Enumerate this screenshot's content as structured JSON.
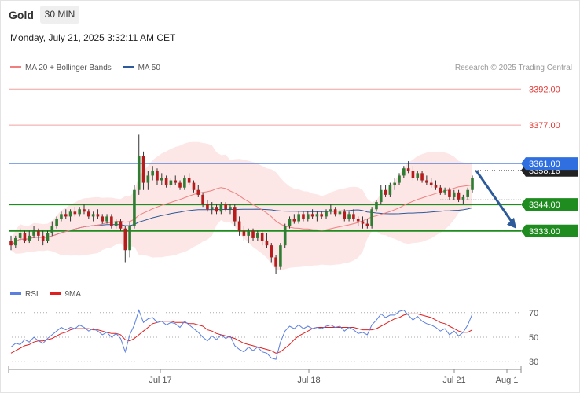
{
  "header": {
    "title": "Gold",
    "interval": "30 MIN",
    "timestamp": "Monday, July 21, 2025 3:32:11 AM CET",
    "copyright": "Research © 2025 Trading Central"
  },
  "legend": {
    "ma20_label": "MA 20 + Bollinger Bands",
    "ma20_color": "#f08080",
    "ma50_label": "MA 50",
    "ma50_color": "#2d5a9a",
    "rsi_label": "RSI",
    "rsi_color": "#5b7fe0",
    "rsi_ma_label": "9MA",
    "rsi_ma_color": "#e02020"
  },
  "colors": {
    "up": "#2e7d32",
    "down": "#b71c1c",
    "resistance": "#e53935",
    "support": "#1e8c1e",
    "pivot": "#3a6fd8",
    "arrow": "#2d5a9a",
    "band_fill": "#fde2e2"
  },
  "chart_data": [
    {
      "type": "candlestick",
      "instrument": "Gold",
      "timeframe": "30 MIN",
      "x_ticks": [
        "Jul 17",
        "Jul 18",
        "Jul 21",
        "Aug 1"
      ],
      "ylim": [
        3312,
        3397
      ],
      "levels": [
        {
          "label": "3392.00",
          "value": 3392,
          "kind": "resistance"
        },
        {
          "label": "3377.00",
          "value": 3377,
          "kind": "resistance"
        },
        {
          "label": "3361.00",
          "value": 3361,
          "kind": "pivot"
        },
        {
          "label": "3358.16",
          "value": 3358.16,
          "kind": "last"
        },
        {
          "label": "3344.00",
          "value": 3344,
          "kind": "support"
        },
        {
          "label": "3333.00",
          "value": 3333,
          "kind": "support"
        }
      ],
      "forecast": {
        "from": 3361,
        "to": 3333,
        "direction": "down"
      },
      "candles": [
        [
          3329,
          3331,
          3325,
          3327
        ],
        [
          3327,
          3331,
          3326,
          3330
        ],
        [
          3330,
          3334,
          3329,
          3332
        ],
        [
          3332,
          3333,
          3328,
          3329
        ],
        [
          3329,
          3333,
          3328,
          3331
        ],
        [
          3331,
          3335,
          3330,
          3333
        ],
        [
          3333,
          3334,
          3329,
          3331
        ],
        [
          3331,
          3333,
          3327,
          3329
        ],
        [
          3329,
          3333,
          3328,
          3332
        ],
        [
          3332,
          3337,
          3331,
          3335
        ],
        [
          3335,
          3339,
          3334,
          3338
        ],
        [
          3338,
          3341,
          3337,
          3340
        ],
        [
          3340,
          3342,
          3338,
          3339
        ],
        [
          3339,
          3342,
          3337,
          3341
        ],
        [
          3341,
          3343,
          3339,
          3340
        ],
        [
          3340,
          3343,
          3339,
          3342
        ],
        [
          3342,
          3344,
          3340,
          3341
        ],
        [
          3341,
          3342,
          3338,
          3339
        ],
        [
          3339,
          3341,
          3337,
          3340
        ],
        [
          3340,
          3342,
          3338,
          3339
        ],
        [
          3339,
          3340,
          3336,
          3337
        ],
        [
          3337,
          3340,
          3336,
          3339
        ],
        [
          3339,
          3340,
          3334,
          3335
        ],
        [
          3335,
          3338,
          3334,
          3337
        ],
        [
          3337,
          3338,
          3333,
          3334
        ],
        [
          3334,
          3335,
          3320,
          3325
        ],
        [
          3325,
          3337,
          3322,
          3335
        ],
        [
          3335,
          3352,
          3334,
          3350
        ],
        [
          3350,
          3373,
          3348,
          3364
        ],
        [
          3364,
          3366,
          3350,
          3353
        ],
        [
          3353,
          3358,
          3350,
          3356
        ],
        [
          3356,
          3360,
          3354,
          3358
        ],
        [
          3358,
          3359,
          3352,
          3354
        ],
        [
          3354,
          3357,
          3352,
          3355
        ],
        [
          3355,
          3356,
          3351,
          3352
        ],
        [
          3352,
          3355,
          3351,
          3354
        ],
        [
          3354,
          3356,
          3352,
          3353
        ],
        [
          3353,
          3354,
          3350,
          3351
        ],
        [
          3351,
          3356,
          3350,
          3355
        ],
        [
          3355,
          3357,
          3352,
          3353
        ],
        [
          3353,
          3354,
          3349,
          3350
        ],
        [
          3350,
          3352,
          3347,
          3348
        ],
        [
          3348,
          3349,
          3343,
          3344
        ],
        [
          3344,
          3346,
          3341,
          3342
        ],
        [
          3342,
          3345,
          3340,
          3343
        ],
        [
          3343,
          3344,
          3340,
          3341
        ],
        [
          3341,
          3345,
          3340,
          3344
        ],
        [
          3344,
          3345,
          3341,
          3342
        ],
        [
          3342,
          3344,
          3340,
          3343
        ],
        [
          3343,
          3344,
          3335,
          3337
        ],
        [
          3337,
          3339,
          3331,
          3333
        ],
        [
          3333,
          3335,
          3329,
          3331
        ],
        [
          3331,
          3334,
          3328,
          3333
        ],
        [
          3333,
          3334,
          3329,
          3330
        ],
        [
          3330,
          3333,
          3329,
          3332
        ],
        [
          3332,
          3333,
          3327,
          3329
        ],
        [
          3329,
          3332,
          3326,
          3327
        ],
        [
          3327,
          3328,
          3320,
          3322
        ],
        [
          3322,
          3323,
          3315,
          3318
        ],
        [
          3318,
          3328,
          3317,
          3327
        ],
        [
          3327,
          3336,
          3326,
          3335
        ],
        [
          3335,
          3339,
          3334,
          3338
        ],
        [
          3338,
          3340,
          3336,
          3337
        ],
        [
          3337,
          3341,
          3336,
          3340
        ],
        [
          3340,
          3341,
          3337,
          3338
        ],
        [
          3338,
          3341,
          3337,
          3340
        ],
        [
          3340,
          3342,
          3338,
          3339
        ],
        [
          3339,
          3341,
          3337,
          3340
        ],
        [
          3340,
          3341,
          3338,
          3339
        ],
        [
          3339,
          3342,
          3338,
          3341
        ],
        [
          3341,
          3344,
          3340,
          3342
        ],
        [
          3342,
          3343,
          3339,
          3340
        ],
        [
          3340,
          3342,
          3339,
          3341
        ],
        [
          3341,
          3342,
          3337,
          3338
        ],
        [
          3338,
          3341,
          3337,
          3340
        ],
        [
          3340,
          3342,
          3337,
          3338
        ],
        [
          3338,
          3339,
          3335,
          3337
        ],
        [
          3337,
          3339,
          3334,
          3336
        ],
        [
          3336,
          3338,
          3334,
          3335
        ],
        [
          3335,
          3343,
          3334,
          3342
        ],
        [
          3342,
          3346,
          3341,
          3345
        ],
        [
          3345,
          3352,
          3344,
          3350
        ],
        [
          3350,
          3352,
          3347,
          3348
        ],
        [
          3348,
          3353,
          3347,
          3352
        ],
        [
          3352,
          3355,
          3350,
          3353
        ],
        [
          3353,
          3357,
          3352,
          3356
        ],
        [
          3356,
          3360,
          3355,
          3359
        ],
        [
          3359,
          3362,
          3357,
          3358
        ],
        [
          3358,
          3360,
          3354,
          3355
        ],
        [
          3355,
          3358,
          3354,
          3357
        ],
        [
          3357,
          3358,
          3353,
          3354
        ],
        [
          3354,
          3356,
          3352,
          3353
        ],
        [
          3353,
          3355,
          3351,
          3352
        ],
        [
          3352,
          3354,
          3350,
          3351
        ],
        [
          3351,
          3352,
          3348,
          3349
        ],
        [
          3349,
          3351,
          3348,
          3350
        ],
        [
          3350,
          3351,
          3346,
          3347
        ],
        [
          3347,
          3350,
          3346,
          3349
        ],
        [
          3349,
          3350,
          3345,
          3346
        ],
        [
          3346,
          3348,
          3344,
          3347
        ],
        [
          3347,
          3351,
          3346,
          3350
        ],
        [
          3350,
          3356,
          3349,
          3355
        ]
      ]
    },
    {
      "type": "line",
      "name": "RSI",
      "x_ticks": [
        "Jul 17",
        "Jul 18",
        "Jul 21",
        "Aug 1"
      ],
      "ylim": [
        25,
        75
      ],
      "y_ticks": [
        30,
        50,
        70
      ],
      "rsi": [
        42,
        45,
        44,
        48,
        46,
        50,
        47,
        45,
        49,
        52,
        55,
        58,
        56,
        58,
        57,
        60,
        58,
        55,
        57,
        55,
        52,
        54,
        50,
        53,
        49,
        38,
        52,
        60,
        72,
        62,
        65,
        66,
        62,
        63,
        60,
        62,
        61,
        58,
        63,
        60,
        57,
        54,
        50,
        47,
        51,
        48,
        52,
        49,
        51,
        43,
        40,
        38,
        42,
        39,
        42,
        38,
        37,
        33,
        32,
        46,
        55,
        59,
        57,
        60,
        57,
        59,
        57,
        58,
        57,
        59,
        60,
        58,
        59,
        55,
        58,
        56,
        53,
        54,
        52,
        60,
        64,
        69,
        66,
        68,
        68,
        71,
        72,
        68,
        64,
        67,
        63,
        61,
        60,
        58,
        55,
        57,
        52,
        55,
        51,
        54,
        60,
        69
      ],
      "rsi_ma": [
        37,
        39,
        41,
        43,
        44,
        46,
        47,
        47,
        48,
        49,
        51,
        53,
        54,
        56,
        57,
        57,
        57,
        57,
        56,
        56,
        55,
        54,
        53,
        53,
        52,
        48,
        47,
        49,
        52,
        55,
        58,
        61,
        62,
        63,
        63,
        63,
        62,
        62,
        62,
        61,
        61,
        60,
        59,
        56,
        55,
        53,
        52,
        51,
        50,
        49,
        47,
        45,
        44,
        43,
        42,
        41,
        40,
        39,
        37,
        38,
        41,
        44,
        48,
        51,
        53,
        55,
        57,
        58,
        58,
        58,
        58,
        58,
        58,
        58,
        58,
        58,
        57,
        56,
        56,
        56,
        57,
        59,
        61,
        63,
        65,
        66,
        68,
        69,
        69,
        69,
        68,
        67,
        66,
        64,
        62,
        61,
        59,
        57,
        55,
        54,
        54,
        56
      ]
    }
  ]
}
